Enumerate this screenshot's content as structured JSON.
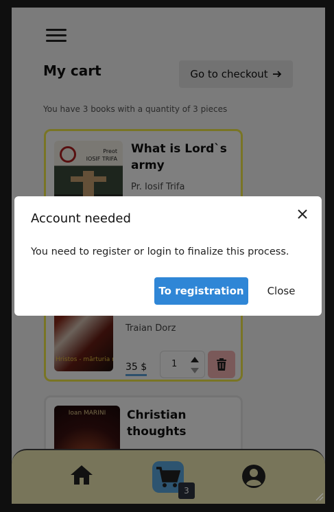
{
  "header": {
    "title": "My cart",
    "checkout_label": "Go to checkout",
    "summary": "You have 3 books with a quantity of 3 pieces"
  },
  "cart": {
    "items": [
      {
        "title": "What is Lord`s army",
        "author": "Pr. Iosif Trifa",
        "cover_text": [
          "Preot",
          "IOSIF TRIFA"
        ]
      },
      {
        "author": "Traian Dorz",
        "price": "35 $",
        "quantity": "1",
        "cover_text": "Hristos - mărturia m"
      },
      {
        "title": "Christian thoughts",
        "cover_text": "Ioan MARINI"
      }
    ]
  },
  "nav": {
    "cart_count": "3",
    "icons": [
      "home-icon",
      "cart-icon",
      "user-icon"
    ]
  },
  "modal": {
    "title": "Account needed",
    "message": "You need to register or login to finalize this process.",
    "primary_label": "To registration",
    "secondary_label": "Close"
  },
  "colors": {
    "primary": "#2f86d6",
    "card_border": "#f2ea48",
    "nav_bg": "#f0ebb4",
    "trash_bg": "#f4b3b3",
    "cart_active": "#5aa8e0"
  }
}
